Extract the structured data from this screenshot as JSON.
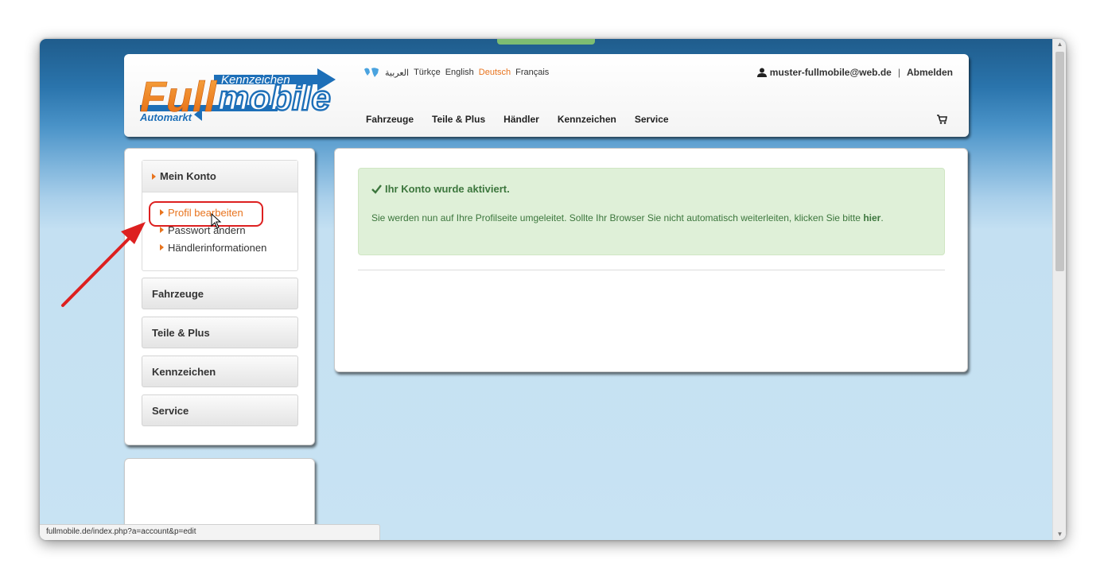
{
  "logo": {
    "main_text": "Fullmobile",
    "tag_top": "Kennzeichen",
    "tag_bottom": "Automarkt"
  },
  "languages": [
    {
      "label": "العربية",
      "active": false
    },
    {
      "label": "Türkçe",
      "active": false
    },
    {
      "label": "English",
      "active": false
    },
    {
      "label": "Deutsch",
      "active": true
    },
    {
      "label": "Français",
      "active": false
    }
  ],
  "user": {
    "email": "muster-fullmobile@web.de",
    "separator": "|",
    "logout_label": "Abmelden"
  },
  "main_nav": [
    "Fahrzeuge",
    "Teile & Plus",
    "Händler",
    "Kennzeichen",
    "Service"
  ],
  "sidebar": {
    "account_title": "Mein Konto",
    "account_items": [
      "Profil bearbeiten",
      "Passwort ändern",
      "Händlerinformationen"
    ],
    "categories": [
      "Fahrzeuge",
      "Teile & Plus",
      "Kennzeichen",
      "Service"
    ]
  },
  "alert": {
    "title": "Ihr Konto wurde aktiviert.",
    "message": "Sie werden nun auf Ihre Profilseite umgeleitet. Sollte Ihr Browser Sie nicht automatisch weiterleiten, klicken Sie bitte",
    "link": "hier",
    "end": "."
  },
  "status_bar": {
    "url": "fullmobile.de/index.php?a=account&p=edit"
  },
  "colors": {
    "accent_orange": "#e8731d",
    "logo_blue": "#1d6fb8",
    "alert_green": "#3c763d",
    "annotation_red": "#dd2020"
  }
}
